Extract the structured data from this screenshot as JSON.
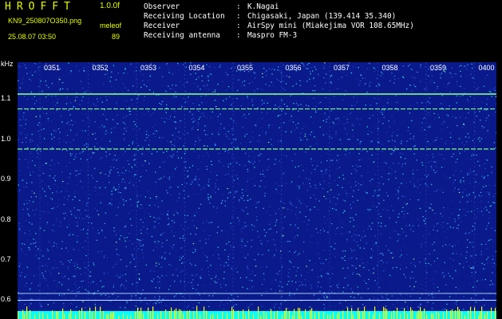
{
  "header": {
    "app_title": "HROFFT",
    "app_version": "1.0.0f",
    "file_name": "KN9_250807O350.png",
    "file_meta": "meleof",
    "date_time": "25.08.07 03:50",
    "file_count": "89"
  },
  "station_info": [
    {
      "label": "Observer",
      "value": "K.Nagai"
    },
    {
      "label": "Receiving Location",
      "value": "Chigasaki, Japan (139.414 35.340)"
    },
    {
      "label": "Receiver",
      "value": "AirSpy mini (Miakejima VOR 108.65MHz)"
    },
    {
      "label": "Receiving antenna",
      "value": "Maspro FM-3"
    }
  ],
  "separator": ":",
  "axes": {
    "y_unit": "kHz",
    "y_ticks": [
      "1.1",
      "1.0",
      "0.9",
      "0.8",
      "0.7",
      "0.6"
    ],
    "x_ticks": [
      "0351",
      "0352",
      "0353",
      "0354",
      "0355",
      "0356",
      "0357",
      "0358",
      "0359",
      "0400"
    ]
  },
  "colors": {
    "background": "#000000",
    "header_accent": "#e8ff00",
    "spectrogram_base": "#0a1a8a",
    "signal_line": "#7fff7f",
    "baseline_band": "#00ffff",
    "baseline_spikes": "#ffff00"
  },
  "signal_lines_khz": [
    1.112,
    1.075,
    0.975
  ],
  "reference_lines_khz": [
    0.615,
    0.598
  ]
}
